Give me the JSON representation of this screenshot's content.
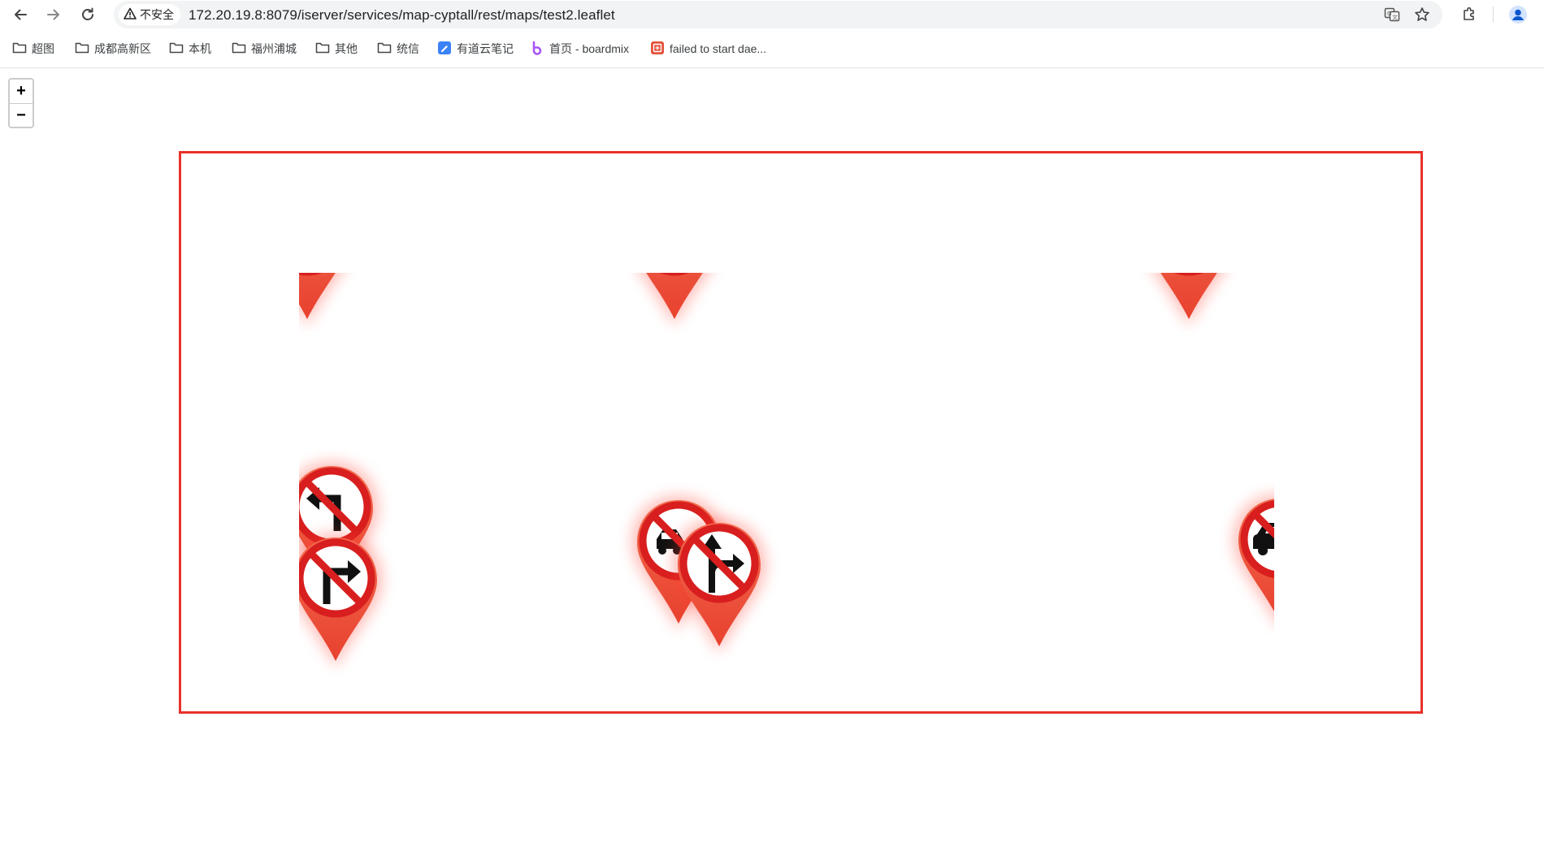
{
  "browser": {
    "security_label": "不安全",
    "url": "172.20.19.8:8079/iserver/services/map-cyptall/rest/maps/test2.leaflet",
    "icons": {
      "back": "back-arrow-icon",
      "forward": "forward-arrow-icon",
      "reload": "reload-icon",
      "warning": "warning-triangle-icon",
      "translate": "translate-icon",
      "bookmark": "star-icon",
      "extensions": "puzzle-icon",
      "profile": "profile-icon"
    }
  },
  "bookmarks": [
    {
      "label": "超图",
      "icon": "folder-icon"
    },
    {
      "label": "成都高新区",
      "icon": "folder-icon"
    },
    {
      "label": "本机",
      "icon": "folder-icon"
    },
    {
      "label": "福州浦城",
      "icon": "folder-icon"
    },
    {
      "label": "其他",
      "icon": "folder-icon"
    },
    {
      "label": "统信",
      "icon": "folder-icon"
    },
    {
      "label": "有道云笔记",
      "icon": "youdao-note-icon"
    },
    {
      "label": "首页 - boardmix",
      "icon": "boardmix-icon"
    },
    {
      "label": "failed to start dae...",
      "icon": "site-favicon-icon"
    }
  ],
  "map": {
    "zoom_in_label": "+",
    "zoom_out_label": "−",
    "frame_color": "#e8312a",
    "markers": [
      {
        "sign": "no-left-turn"
      },
      {
        "sign": "no-right-turn"
      },
      {
        "sign": "no-motor-vehicles"
      },
      {
        "sign": "no-straight-or-right-turn"
      },
      {
        "sign": "no-cars"
      }
    ]
  }
}
